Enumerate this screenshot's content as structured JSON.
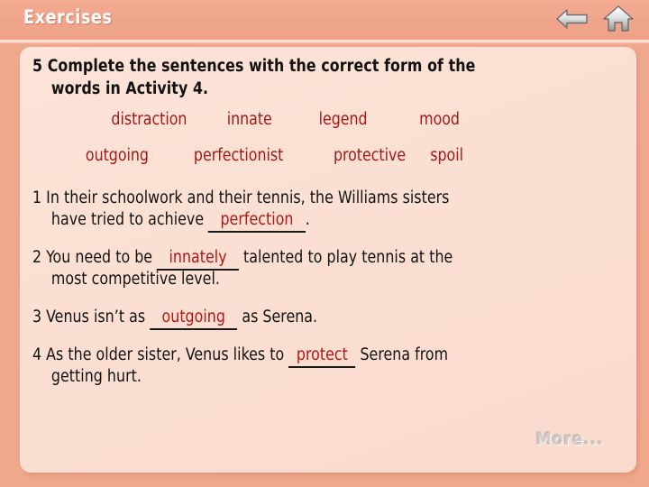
{
  "header": {
    "title": "Exercises",
    "icons": [
      {
        "name": "back-arrow-icon",
        "label": "Back"
      },
      {
        "name": "home-icon",
        "label": "Home"
      }
    ]
  },
  "main": {
    "instruction": {
      "number": "5",
      "line1": "Complete the sentences with the correct form of the",
      "line2": "words in Activity 4."
    },
    "wordbank": {
      "row1": [
        "distraction",
        "innate",
        "legend",
        "mood"
      ],
      "row2": [
        "outgoing",
        "perfectionist",
        "protective",
        "spoil"
      ]
    },
    "questions": [
      {
        "number": "1",
        "before": "In their schoolwork and their tennis, the Williams sisters",
        "cont_before": "have tried to achieve ",
        "answer": "perfection",
        "cont_after": "."
      },
      {
        "number": "2",
        "before": "You need to be ",
        "answer": "innately",
        "after": " talented to play tennis at the",
        "cont": "most competitive level."
      },
      {
        "number": "3",
        "before": "Venus isn’t as ",
        "answer": "outgoing",
        "after": " as Serena."
      },
      {
        "number": "4",
        "before": "As the older sister, Venus likes to ",
        "answer": "protect",
        "after": " Serena from",
        "cont": "getting hurt."
      }
    ]
  },
  "footer": {
    "more_label": "More..."
  },
  "colors": {
    "page_background": "#f0a78c",
    "header_background": "#efa288",
    "panel_background": "#fadfd2",
    "header_title": "#ffffff",
    "body_text": "#111111",
    "answer_text": "#b01515",
    "wordbank_text": "#a01818",
    "more_text": "#c9c9c9"
  }
}
